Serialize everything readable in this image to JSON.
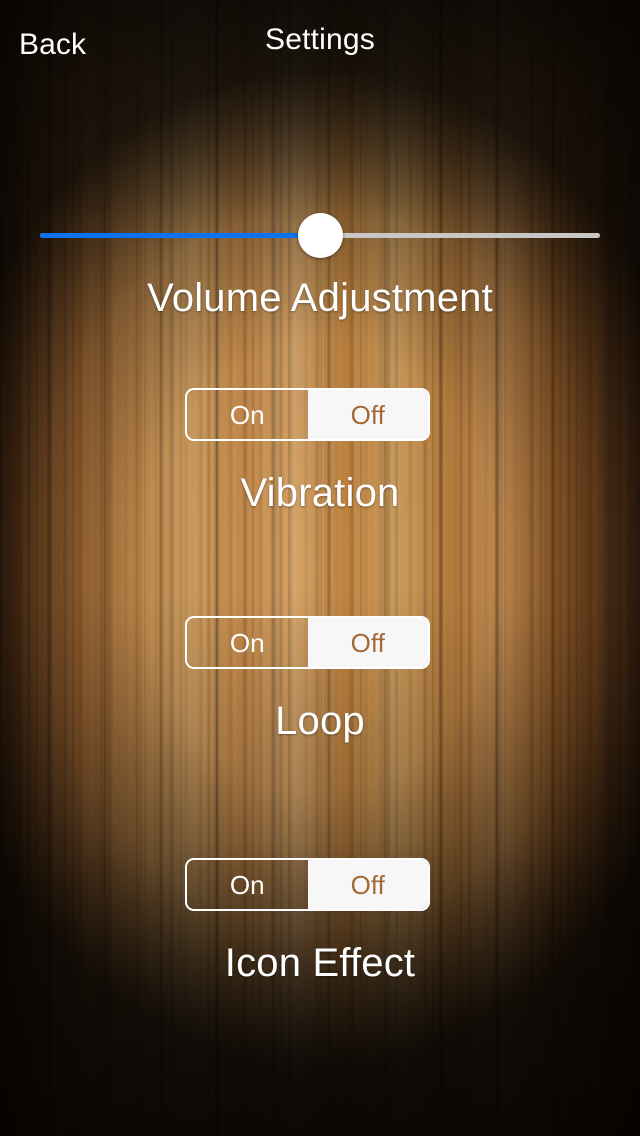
{
  "navbar": {
    "back_label": "Back",
    "title": "Settings"
  },
  "slider": {
    "name": "volume-slider",
    "value_percent": 50,
    "fill_color": "#0d72f0",
    "track_color": "#c9c7c5",
    "thumb_color": "#ffffff"
  },
  "sections": [
    {
      "label": "Volume Adjustment",
      "control": "slider"
    },
    {
      "label": "Vibration",
      "control": "segmented",
      "options": [
        "On",
        "Off"
      ],
      "selected": "On"
    },
    {
      "label": "Loop",
      "control": "segmented",
      "options": [
        "On",
        "Off"
      ],
      "selected": "On"
    },
    {
      "label": "Icon Effect",
      "control": "segmented",
      "options": [
        "On",
        "Off"
      ],
      "selected": "On"
    }
  ],
  "colors": {
    "accent_blue": "#0d72f0",
    "selected_text": "#ffffff",
    "unselected_text": "#a36a38",
    "unselected_fill": "#f7f7f7",
    "label_text": "#ffffff"
  }
}
